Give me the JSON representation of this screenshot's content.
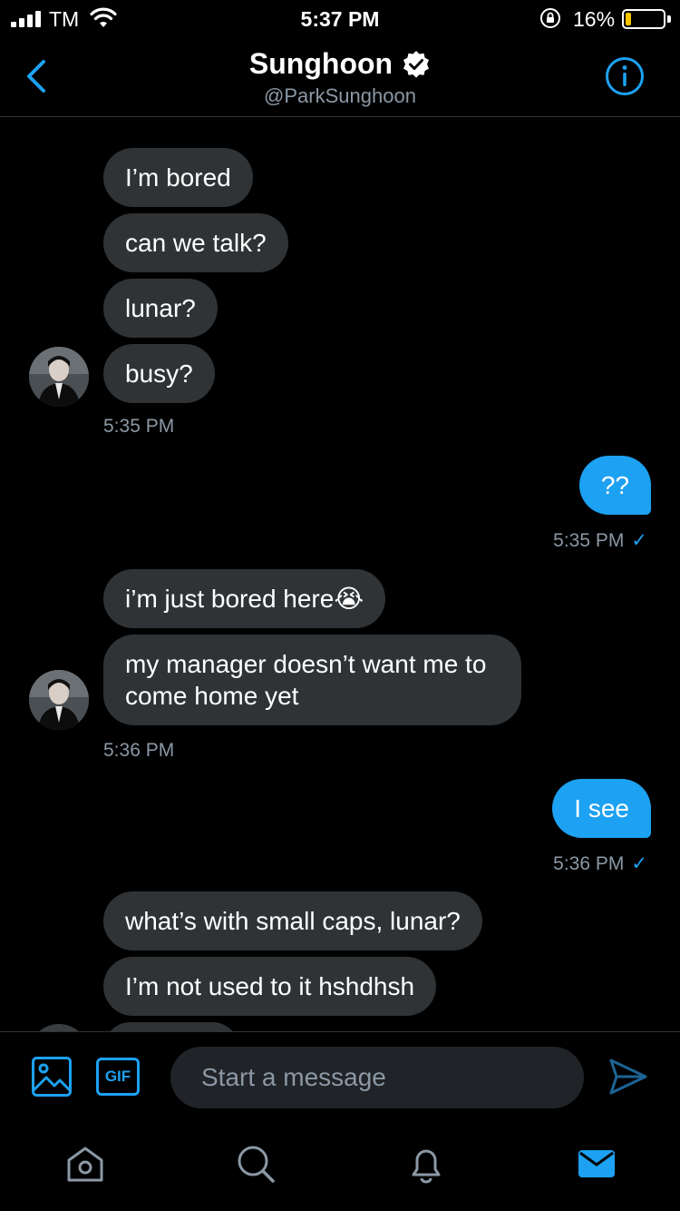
{
  "status_bar": {
    "carrier": "TM",
    "time": "5:37 PM",
    "battery_percent": "16%",
    "battery_level": 0.16,
    "battery_color": "#f5c400"
  },
  "header": {
    "title": "Sunghoon",
    "handle": "@ParkSunghoon",
    "icons": [
      "chevron-left-icon",
      "verified-badge-icon",
      "info-icon"
    ]
  },
  "messages": [
    {
      "direction": "in",
      "text": "I’m bored"
    },
    {
      "direction": "in",
      "text": "can we talk?"
    },
    {
      "direction": "in",
      "text": "lunar?"
    },
    {
      "direction": "in",
      "text": "busy?"
    },
    {
      "direction": "in",
      "time": "5:35 PM"
    },
    {
      "direction": "out",
      "text": "??"
    },
    {
      "direction": "out",
      "time": "5:35 PM"
    },
    {
      "direction": "in",
      "text": "i’m just bored here😭"
    },
    {
      "direction": "in",
      "text": "my manager doesn’t want me to come home yet"
    },
    {
      "direction": "in",
      "time": "5:36 PM"
    },
    {
      "direction": "out",
      "text": "I see"
    },
    {
      "direction": "out",
      "time": "5:36 PM"
    },
    {
      "direction": "in",
      "text": "what’s with small caps, lunar?"
    },
    {
      "direction": "in",
      "text": "I’m not used to it hshdhsh"
    }
  ],
  "composer": {
    "placeholder": "Start a message",
    "gif_label": "GIF",
    "icons": [
      "image-icon",
      "gif-icon",
      "send-icon"
    ]
  },
  "tabbar": {
    "icons": [
      "home-icon",
      "search-icon",
      "notifications-bell-icon",
      "messages-mail-icon"
    ],
    "active": "messages-mail-icon"
  },
  "colors": {
    "accent": "#1da1f2",
    "incoming_bubble": "#2f3336",
    "background": "#000000",
    "secondary_text": "#8b98a5"
  }
}
